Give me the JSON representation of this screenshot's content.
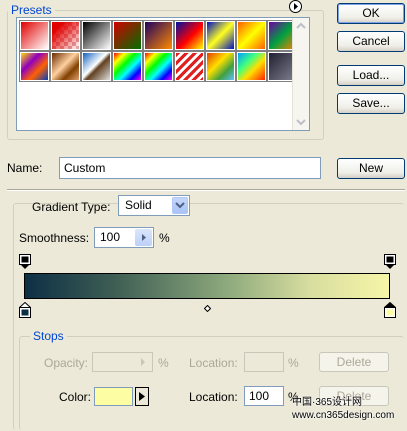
{
  "presets": {
    "label": "Presets",
    "swatches": [
      {
        "name": "foreground-to-background",
        "bg": "linear-gradient(135deg,#e00000,#ffffff)"
      },
      {
        "name": "foreground-to-transparent",
        "bg": "linear-gradient(135deg,#e00000 20%,rgba(255,255,255,0)),repeating-conic-gradient(#ffffff 0 25%,#e0b0b0 0 50%) 0 0/8px 8px"
      },
      {
        "name": "black-white",
        "bg": "linear-gradient(135deg,#000000,#ffffff)"
      },
      {
        "name": "red-green",
        "bg": "linear-gradient(135deg,#d00000,#007000)"
      },
      {
        "name": "violet-orange",
        "bg": "linear-gradient(135deg,#200060,#ff8a00)"
      },
      {
        "name": "blue-red-yellow",
        "bg": "linear-gradient(135deg,#0010a0,#ff0000 55%,#ffff00)"
      },
      {
        "name": "blue-yellow-blue",
        "bg": "linear-gradient(135deg,#0010c0,#ffff20 50%,#0010c0)"
      },
      {
        "name": "orange-yellow-orange",
        "bg": "linear-gradient(135deg,#ff6000,#ffff00 50%,#ff6000)"
      },
      {
        "name": "violet-green-orange",
        "bg": "linear-gradient(135deg,#7000a0,#00a040 50%,#ff8000)"
      },
      {
        "name": "yellow-violet-orange-blue",
        "bg": "linear-gradient(135deg,#ffe000,#9000c0 35%,#ff6000 65%,#0040c0)"
      },
      {
        "name": "copper",
        "bg": "linear-gradient(135deg,#6a2a00,#ffd0a0 45%,#804000 70%,#e0a070)"
      },
      {
        "name": "chrome",
        "bg": "linear-gradient(135deg,#1060c0,#ffffff 45%,#604020 55%,#e0e0e0)"
      },
      {
        "name": "spectrum",
        "bg": "linear-gradient(135deg,#ff0000,#ffff00,#00ff00,#00ffff,#0000ff,#ff00ff)"
      },
      {
        "name": "transparent-rainbow",
        "bg": "linear-gradient(135deg,#ff0000,#ffff00,#00ff00,#00ffff,#0000ff,#ff00ff),repeating-conic-gradient(#ffffff 0 25%,#d0d0d0 0 50%) 0 0/8px 8px"
      },
      {
        "name": "transparent-stripes",
        "bg": "repeating-linear-gradient(135deg,#e02020 0 3px,#ffffff 3px 6px)"
      },
      {
        "name": "yellow-green-stripe",
        "bg": "linear-gradient(135deg,#e04000,#ffe000 40%,#40a040 70%,#60c0ff)"
      },
      {
        "name": "rainbow-soft",
        "bg": "linear-gradient(135deg,#00a0ff,#40ff80 35%,#ffe000 60%,#ff2000)"
      },
      {
        "name": "dark-steel",
        "bg": "linear-gradient(135deg,#202030,#808090)"
      }
    ]
  },
  "buttons": {
    "ok": "OK",
    "cancel": "Cancel",
    "load": "Load...",
    "save": "Save...",
    "new": "New",
    "delete_opacity": "Delete",
    "delete_color": "Delete"
  },
  "name_label": "Name:",
  "name_value": "Custom",
  "gradient_type": {
    "label": "Gradient Type:",
    "value": "Solid"
  },
  "smoothness": {
    "label": "Smoothness:",
    "value": "100",
    "unit": "%"
  },
  "gradient": {
    "bar": "linear-gradient(90deg,#0d2f45 0%,#3f5f54 25%,#8ca87c 55%,#d7dd9f 78%,#f7f6a8 100%)",
    "midpoint_percent": 50
  },
  "stops": {
    "label": "Stops",
    "opacity": {
      "label": "Opacity:",
      "value": "",
      "unit": "%"
    },
    "opacity_location": {
      "label": "Location:",
      "value": "",
      "unit": "%"
    },
    "color": {
      "label": "Color:",
      "swatch": "#fdfda4"
    },
    "color_location": {
      "label": "Location:",
      "value": "100",
      "unit": "%"
    }
  },
  "watermark": "中国·365设计网\nwww.cn365design.com"
}
